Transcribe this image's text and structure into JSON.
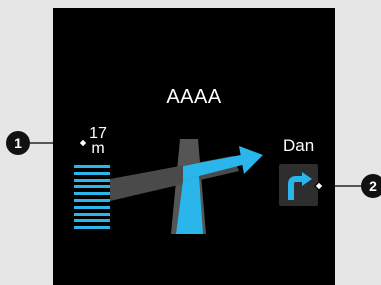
{
  "display": {
    "street_name": "AAAA",
    "distance_value": "17",
    "distance_unit": "m",
    "next_turn_label": "Dan",
    "lane_arrow_icon": "turn-right-arrow-icon",
    "distance_bar_count": 10
  },
  "callouts": [
    {
      "label": "1",
      "target": "distance-indicator"
    },
    {
      "label": "2",
      "target": "lane-icon"
    }
  ],
  "colors": {
    "background": "#e6e6e7",
    "screen": "#000000",
    "accent": "#2ab6ea",
    "road": "#555555",
    "text": "#ffffff"
  }
}
